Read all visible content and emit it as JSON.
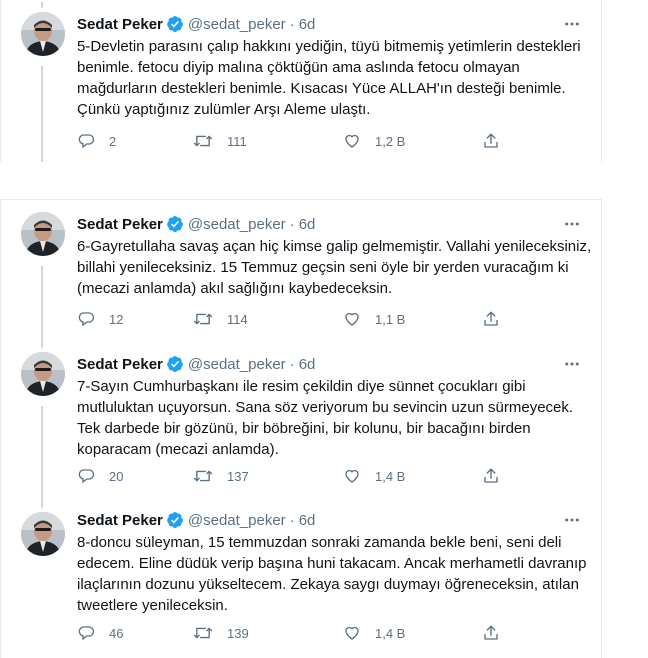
{
  "colors": {
    "accent": "#1da1f2",
    "text": "#0f1419",
    "secondary": "#5b7083",
    "border": "#e6ecf0",
    "thread_line": "#ccd6dd"
  },
  "icons": {
    "reply": "reply-icon",
    "retweet": "retweet-icon",
    "like": "heart-icon",
    "share": "share-icon",
    "more": "more-icon",
    "verified": "verified-badge-icon"
  },
  "tweets": [
    {
      "name": "Sedat Peker",
      "handle": "@sedat_peker",
      "dot": "·",
      "time": "6d",
      "text": "5-Devletin parasını çalıp hakkını yediğin, tüyü bitmemiş yetimlerin destekleri\nbenimle. fetocu diyip malına çöktüğün ama aslında fetocu olmayan\nmağdurların destekleri benimle. Kısacası Yüce ALLAH'ın desteği benimle.\nÇünkü yaptığınız zulümler Arşı Aleme ulaştı.",
      "replies": "2",
      "retweets": "111",
      "likes": "1,2 B"
    },
    {
      "name": "Sedat Peker",
      "handle": "@sedat_peker",
      "dot": "·",
      "time": "6d",
      "text": "6-Gayretullaha savaş açan hiç kimse galip gelmemiştir. Vallahi yenileceksiniz,\nbillahi yenileceksiniz. 15 Temmuz geçsin seni öyle bir yerden vuracağım ki\n(mecazi anlamda) akıl sağlığını kaybedeceksin.",
      "replies": "12",
      "retweets": "114",
      "likes": "1,1 B"
    },
    {
      "name": "Sedat Peker",
      "handle": "@sedat_peker",
      "dot": "·",
      "time": "6d",
      "text": "7-Sayın Cumhurbaşkanı ile resim çekildin diye sünnet çocukları gibi\nmutluluktan uçuyorsun. Sana söz veriyorum bu sevincin uzun sürmeyecek.\nTek darbede bir gözünü, bir böbreğini, bir kolunu, bir bacağını birden\nkoparacam (mecazi anlamda).",
      "replies": "20",
      "retweets": "137",
      "likes": "1,4 B"
    },
    {
      "name": "Sedat Peker",
      "handle": "@sedat_peker",
      "dot": "·",
      "time": "6d",
      "text": "8-doncu süleyman, 15 temmuzdan sonraki zamanda bekle beni, seni deli\nedecem. Eline düdük verip başına huni takacam. Ancak merhametli davranıp\nilaçlarının dozunu yükseltecem. Zekaya saygı duymayı öğreneceksin, atılan\ntweetlere yenileceksin.",
      "replies": "46",
      "retweets": "139",
      "likes": "1,4 B"
    }
  ]
}
